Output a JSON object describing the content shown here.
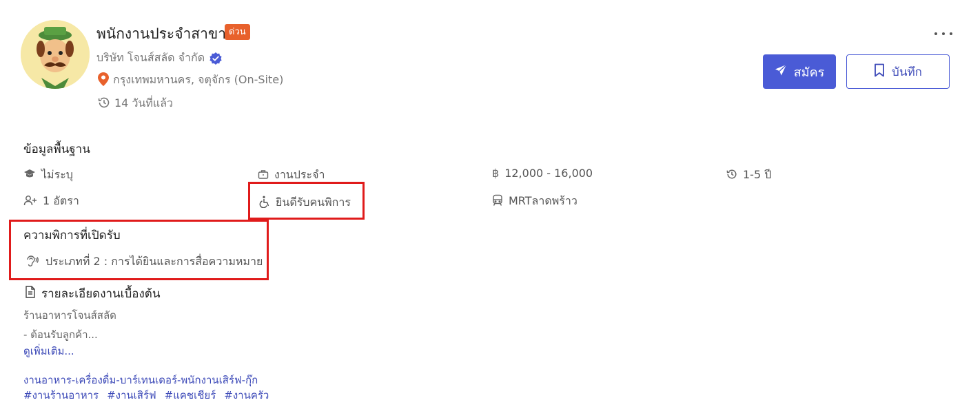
{
  "job": {
    "title": "พนักงานประจำสาขา",
    "urgent_badge": "ด่วน",
    "company": "บริษัท โจนส์สลัด จำกัด",
    "location": "กรุงเทพมหานคร, จตุจักร (On-Site)",
    "posted": "14 วันที่แล้ว"
  },
  "actions": {
    "apply_label": "สมัคร",
    "save_label": "บันทึก"
  },
  "basic_info": {
    "heading": "ข้อมูลพื้นฐาน",
    "education": "ไม่ระบุ",
    "job_type": "งานประจำ",
    "salary": "12,000 - 16,000",
    "experience": "1-5 ปี",
    "positions": "1 อัตรา",
    "disability_welcome": "ยินดีรับคนพิการ",
    "transit": "MRTลาดพร้าว"
  },
  "disability": {
    "heading": "ความพิการที่เปิดรับ",
    "type": "ประเภทที่ 2 : การได้ยินและการสื่อความหมาย"
  },
  "description": {
    "heading": "รายละเอียดงานเบื้องต้น",
    "line1": "ร้านอาหารโจนส์สลัด",
    "line2": "- ต้อนรับลูกค้า...",
    "see_more": "ดูเพิ่มเติม...",
    "category": "งานอาหาร-เครื่องดื่ม-บาร์เทนเดอร์-พนักงานเสิร์ฟ-กุ๊ก",
    "tags": [
      "#งานร้านอาหาร",
      "#งานเสิร์ฟ",
      "#แคชเชียร์",
      "#งานครัว"
    ]
  },
  "icons": {
    "company_logo": "chef-mascot-logo",
    "verified": "verified-check-icon",
    "location": "map-pin-icon",
    "posted": "history-icon",
    "education": "graduation-cap-icon",
    "job_type": "briefcase-icon",
    "salary": "baht-icon",
    "experience": "history-icon",
    "positions": "add-user-icon",
    "disability": "wheelchair-icon",
    "transit": "train-icon",
    "hearing": "ear-icon",
    "description": "document-icon"
  },
  "colors": {
    "primary": "#4a5bd6",
    "urgent": "#e8612c",
    "location_pin": "#e8612c",
    "highlight": "#e01b1b"
  }
}
